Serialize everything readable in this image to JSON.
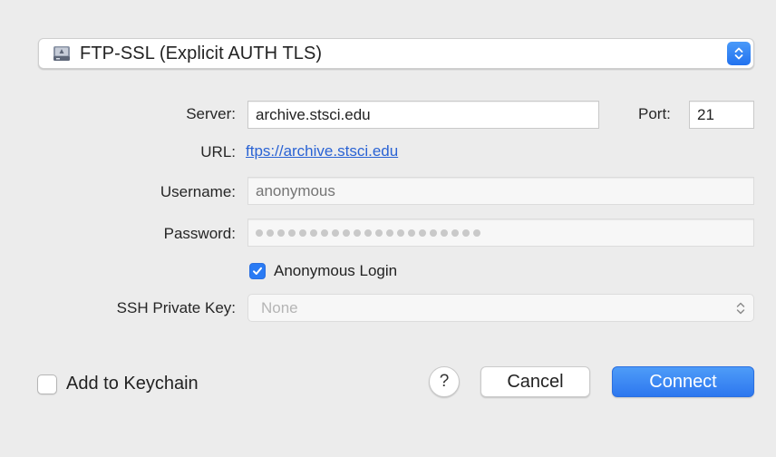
{
  "protocol": {
    "selected": "FTP-SSL (Explicit AUTH TLS)",
    "icon": "drive-icon"
  },
  "form": {
    "server_label": "Server:",
    "server_value": "archive.stsci.edu",
    "port_label": "Port:",
    "port_value": "21",
    "url_label": "URL:",
    "url_value": "ftps://archive.stsci.edu",
    "username_label": "Username:",
    "username_placeholder": "anonymous",
    "password_label": "Password:",
    "password_dot_count": 21,
    "anonymous_login_label": "Anonymous Login",
    "anonymous_login_checked": true,
    "ssh_key_label": "SSH Private Key:",
    "ssh_key_value": "None"
  },
  "footer": {
    "keychain_label": "Add to Keychain",
    "keychain_checked": false,
    "help_label": "?",
    "cancel_label": "Cancel",
    "connect_label": "Connect"
  },
  "colors": {
    "accent": "#2a7bf4",
    "link": "#2a63d4",
    "background": "#ececec"
  }
}
